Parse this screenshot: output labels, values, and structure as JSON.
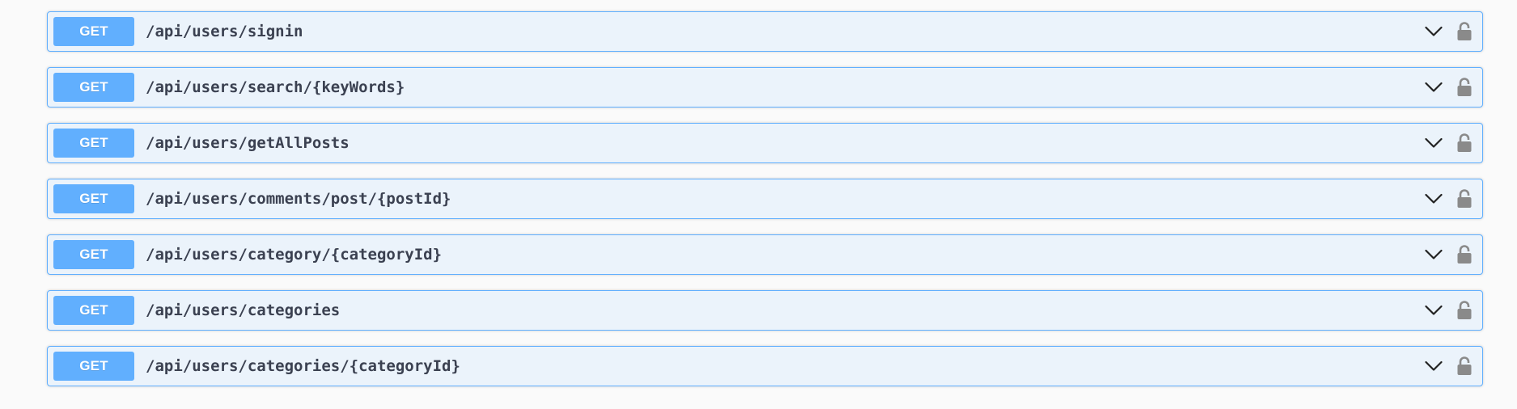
{
  "operations": [
    {
      "method": "GET",
      "path": "/api/users/signin"
    },
    {
      "method": "GET",
      "path": "/api/users/search/{keyWords}"
    },
    {
      "method": "GET",
      "path": "/api/users/getAllPosts"
    },
    {
      "method": "GET",
      "path": "/api/users/comments/post/{postId}"
    },
    {
      "method": "GET",
      "path": "/api/users/category/{categoryId}"
    },
    {
      "method": "GET",
      "path": "/api/users/categories"
    },
    {
      "method": "GET",
      "path": "/api/users/categories/{categoryId}"
    }
  ],
  "icons": {
    "expand": "chevron-down-icon",
    "auth": "lock-icon"
  },
  "colors": {
    "get_method": "#61affe",
    "get_background": "#ebf3fb",
    "path_text": "#3b4151",
    "icon": "#8a8a8a"
  }
}
